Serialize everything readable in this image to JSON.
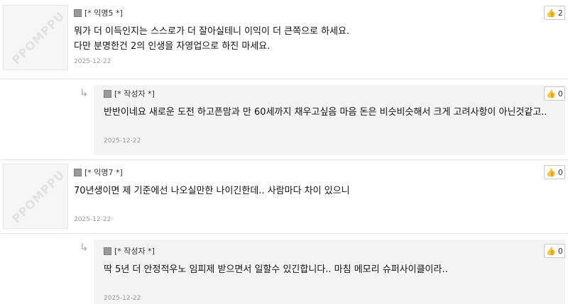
{
  "avatar_text": "PPOMPPU",
  "comments": [
    {
      "nick": "[* 익명5 *]",
      "lines": [
        "뭐가 더 이득인지는 스스로가 더 잘아실테니 이익이 더 큰쪽으로 하세요.",
        "다만 분명한건 2의 인생을 자영업으로 하진 마세요."
      ],
      "date": "2025-12-22",
      "likes": "2"
    },
    {
      "nick": "[* 작성자 *]",
      "lines": [
        "반반이네요 새로운 도전 하고픈맘과 만 60세까지 채우고싶음 마음 돈은 비슷비슷해서 크게 고려사항이 아닌것같고.."
      ],
      "date": "2025-12-22",
      "likes": "0"
    },
    {
      "nick": "[* 익명7 *]",
      "lines": [
        "70년생이면  제 기준에선 나오실만한 나이긴한데.. 사람마다 차이 있으니"
      ],
      "date": "2025-12-22",
      "likes": "0"
    },
    {
      "nick": "[* 작성자 *]",
      "lines": [
        "딱 5년 더 안정적우노 임피제 받으면서 일할수 있긴합니다.. 마침 메모리 슈퍼사이클이라.."
      ],
      "date": "2025-12-22",
      "likes": "0"
    }
  ]
}
